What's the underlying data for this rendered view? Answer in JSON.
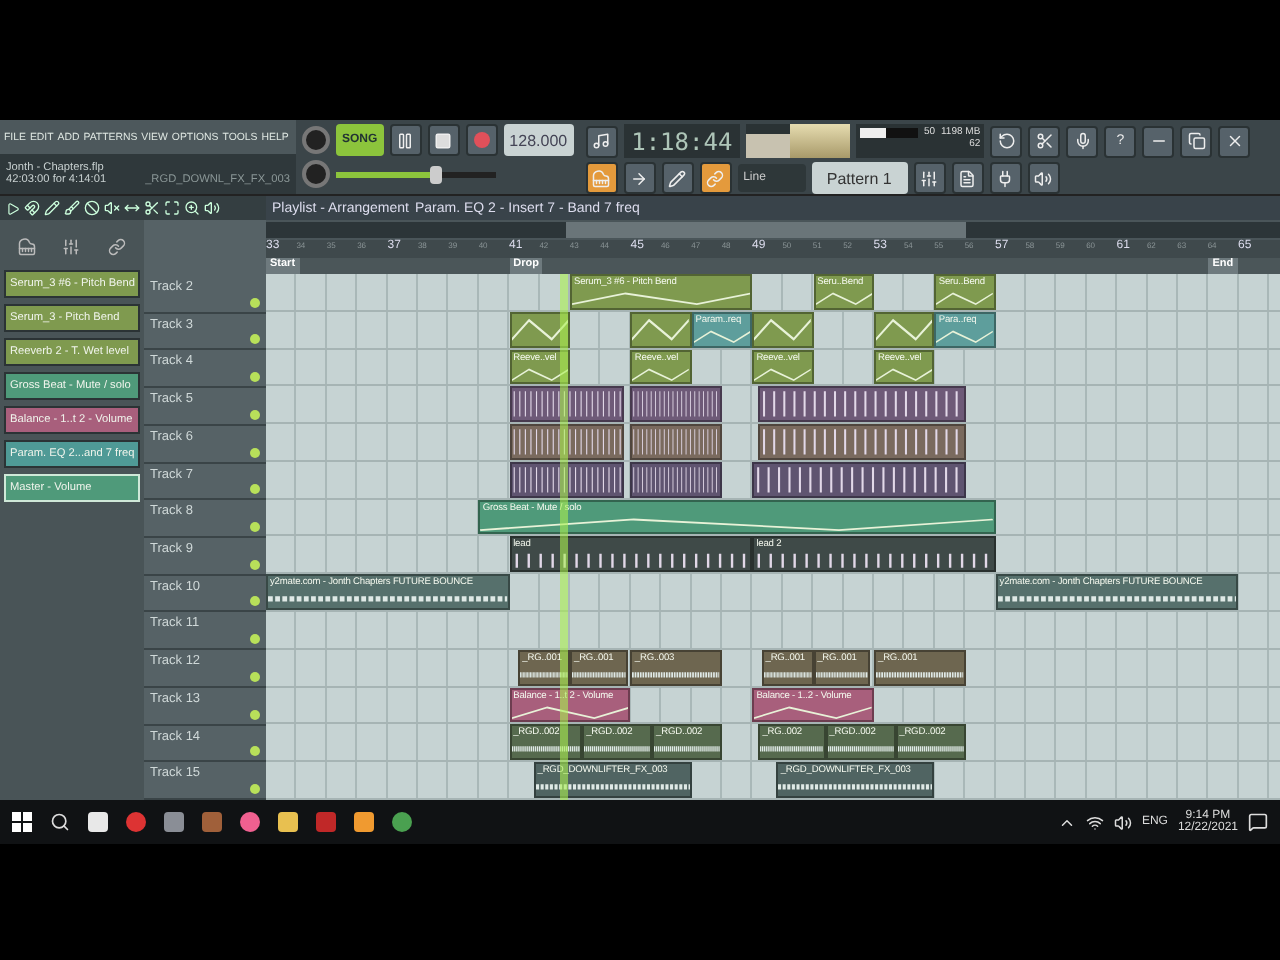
{
  "menu": [
    "FILE",
    "EDIT",
    "ADD",
    "PATTERNS",
    "VIEW",
    "OPTIONS",
    "TOOLS",
    "HELP"
  ],
  "project": {
    "title": "Jonth - Chapters.flp",
    "time": "42:03:00 for 4:14:01",
    "hint": "_RGD_DOWNL_FX_FX_003"
  },
  "transport": {
    "mode": "SONG",
    "tempo": "128.000",
    "time": "1:18:44"
  },
  "master_pitch": {
    "level": 0.62
  },
  "monitor": {
    "value": "50",
    "memory": "1198 MB",
    "polyphony": "62",
    "level": 0.45
  },
  "snap": "Line",
  "pattern": "Pattern 1",
  "help": "?",
  "playlist": {
    "title": "Playlist - Arrangement",
    "path": "Param. EQ 2 - Insert 7 - Band 7 freq",
    "ruler": [
      "33",
      "34",
      "35",
      "36",
      "37",
      "38",
      "39",
      "40",
      "41",
      "42",
      "43",
      "44",
      "45",
      "46",
      "47",
      "48",
      "49",
      "50",
      "51",
      "52",
      "53",
      "54",
      "55",
      "56",
      "57",
      "58",
      "59",
      "60",
      "61",
      "62",
      "63",
      "64",
      "65"
    ],
    "markers": [
      "Start",
      "Drop",
      "End"
    ],
    "playhead": {
      "level": 0.29
    }
  },
  "browser": [
    {
      "label": "Serum_3 #6 - Pitch Bend",
      "color": "#7f9a4f",
      "selected": false
    },
    {
      "label": "Serum_3 - Pitch Bend",
      "color": "#7f9a4f",
      "selected": false
    },
    {
      "label": "Reeverb 2 - T. Wet level",
      "color": "#7f9a4f",
      "selected": false
    },
    {
      "label": "Gross Beat - Mute / solo",
      "color": "#4f9a7a",
      "selected": false
    },
    {
      "label": "Balance - 1..t 2 - Volume",
      "color": "#a85f7c",
      "selected": false
    },
    {
      "label": "Param. EQ 2...and 7 freq",
      "color": "#4f9a96",
      "selected": false
    },
    {
      "label": "Master - Volume",
      "color": "#4f9a7a",
      "selected": true
    }
  ],
  "tracks": [
    {
      "name": "Track 2",
      "clips": [
        {
          "kind": "automation",
          "label": "Serum_3 #6 - Pitch Bend",
          "color": "#7f9a4f"
        },
        {
          "kind": "automation",
          "label": "Seru..Bend",
          "color": "#7f9a4f"
        },
        {
          "kind": "automation",
          "label": "Seru..Bend",
          "color": "#7f9a4f"
        }
      ]
    },
    {
      "name": "Track 3",
      "clips": [
        {
          "kind": "automation",
          "color": "#7f9a4f"
        },
        {
          "kind": "automation",
          "color": "#7f9a4f"
        },
        {
          "kind": "automation",
          "label": "Param..req",
          "color": "#5e9e9c"
        },
        {
          "kind": "automation",
          "color": "#7f9a4f"
        },
        {
          "kind": "automation",
          "color": "#7f9a4f"
        },
        {
          "kind": "automation",
          "label": "Para..req",
          "color": "#5e9e9c"
        }
      ]
    },
    {
      "name": "Track 4",
      "clips": [
        {
          "kind": "automation",
          "label": "Reeve..vel",
          "color": "#7f9a4f"
        },
        {
          "kind": "automation",
          "label": "Reeve..vel",
          "color": "#7f9a4f"
        },
        {
          "kind": "automation",
          "label": "Reeve..vel",
          "color": "#7f9a4f"
        },
        {
          "kind": "automation",
          "label": "Reeve..vel",
          "color": "#7f9a4f"
        }
      ]
    },
    {
      "name": "Track 5",
      "clips": [
        {
          "kind": "pattern",
          "color": "#6e5a78"
        },
        {
          "kind": "pattern",
          "color": "#6e5a78"
        },
        {
          "kind": "pattern",
          "color": "#6e5a78"
        }
      ]
    },
    {
      "name": "Track 6",
      "clips": [
        {
          "kind": "pattern",
          "color": "#7a6a5e"
        },
        {
          "kind": "pattern",
          "color": "#7a6a5e"
        },
        {
          "kind": "pattern",
          "color": "#7a6a5e"
        }
      ]
    },
    {
      "name": "Track 7",
      "clips": [
        {
          "kind": "pattern",
          "color": "#5f5470"
        },
        {
          "kind": "pattern",
          "color": "#5f5470"
        },
        {
          "kind": "pattern",
          "color": "#5f5470"
        }
      ]
    },
    {
      "name": "Track 8",
      "clips": [
        {
          "kind": "automation",
          "label": "Gross Beat - Mute / solo",
          "color": "#4f9a7a"
        }
      ]
    },
    {
      "name": "Track 9",
      "clips": [
        {
          "kind": "pattern",
          "label": "lead",
          "color": "#3f4a48"
        },
        {
          "kind": "pattern",
          "label": "lead 2",
          "color": "#3f4a48"
        }
      ]
    },
    {
      "name": "Track 10",
      "clips": [
        {
          "kind": "audio",
          "label": "y2mate.com - Jonth Chapters FUTURE BOUNCE",
          "color": "#56706c"
        },
        {
          "kind": "audio",
          "label": "y2mate.com - Jonth Chapters FUTURE BOUNCE",
          "color": "#56706c"
        }
      ]
    },
    {
      "name": "Track 11"
    },
    {
      "name": "Track 12",
      "clips": [
        {
          "kind": "audio",
          "label": "_RG..001",
          "color": "#6e6650"
        },
        {
          "kind": "audio",
          "label": "_RG..001",
          "color": "#6e6650"
        },
        {
          "kind": "audio",
          "label": "_RG..003",
          "color": "#6e6650"
        },
        {
          "kind": "audio",
          "label": "_RG..001",
          "color": "#6e6650"
        },
        {
          "kind": "audio",
          "label": "_RG..001",
          "color": "#6e6650"
        },
        {
          "kind": "audio",
          "label": "_RG..001",
          "color": "#6e6650"
        }
      ]
    },
    {
      "name": "Track 13",
      "clips": [
        {
          "kind": "automation",
          "label": "Balance - 1..t 2 - Volume",
          "color": "#a85f7c"
        },
        {
          "kind": "automation",
          "label": "Balance - 1..2 - Volume",
          "color": "#a85f7c"
        }
      ]
    },
    {
      "name": "Track 14",
      "clips": [
        {
          "kind": "audio",
          "label": "_RGD..002",
          "color": "#566a4e"
        },
        {
          "kind": "audio",
          "label": "_RGD..002",
          "color": "#566a4e"
        },
        {
          "kind": "audio",
          "label": "_RGD..002",
          "color": "#566a4e"
        },
        {
          "kind": "audio",
          "label": "_RG..002",
          "color": "#566a4e"
        },
        {
          "kind": "audio",
          "label": "_RGD..002",
          "color": "#566a4e"
        },
        {
          "kind": "audio",
          "label": "_RGD..002",
          "color": "#566a4e"
        }
      ]
    },
    {
      "name": "Track 15",
      "clips": [
        {
          "kind": "audio",
          "label": "_RGD_DOWNLIFTER_FX_003",
          "color": "#506462"
        },
        {
          "kind": "audio",
          "label": "_RGD_DOWNLIFTER_FX_003",
          "color": "#506462"
        }
      ]
    }
  ],
  "taskbar": {
    "language": "ENG",
    "time": "9:14 PM",
    "date": "12/22/2021"
  }
}
